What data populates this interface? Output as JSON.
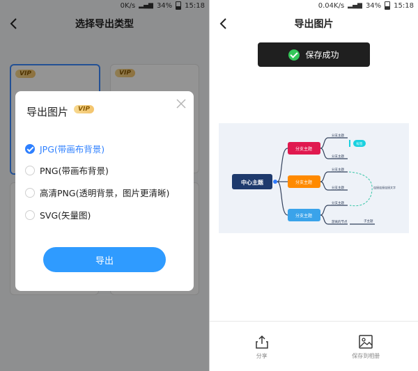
{
  "left": {
    "status": {
      "speed": "0K/s",
      "battery": "34%",
      "time": "15:18"
    },
    "nav": {
      "title": "选择导出类型"
    },
    "cards": {
      "vip1": "VIP",
      "vip2": "VIP"
    },
    "dialog": {
      "title": "导出图片",
      "vip": "VIP",
      "options": [
        {
          "label": "JPG(带画布背景)",
          "checked": true
        },
        {
          "label": "PNG(带画布背景)",
          "checked": false
        },
        {
          "label": "高清PNG(透明背景，图片更清晰)",
          "checked": false
        },
        {
          "label": "SVG(矢量图)",
          "checked": false
        }
      ],
      "export_label": "导出"
    }
  },
  "right": {
    "status": {
      "speed": "0.04K/s",
      "battery": "34%",
      "time": "15:18"
    },
    "nav": {
      "title": "导出图片"
    },
    "toast": "保存成功",
    "mindmap": {
      "center": "中心主题",
      "branches": [
        {
          "label": "分支主题",
          "color": "#e0194f",
          "children": [
            "分支主题",
            "分支主题"
          ]
        },
        {
          "label": "分支主题",
          "color": "#ff8a00",
          "children": [
            "分支主题",
            "分支主题"
          ]
        },
        {
          "label": "分支主题",
          "color": "#3aa3ea",
          "children": [
            "分支主题",
            "游离的节点"
          ]
        }
      ],
      "tag": "标签",
      "note": "连接连接连接文字",
      "subtopic": "子主题"
    },
    "bottom": {
      "share": "分享",
      "save_album": "保存到相册"
    }
  }
}
